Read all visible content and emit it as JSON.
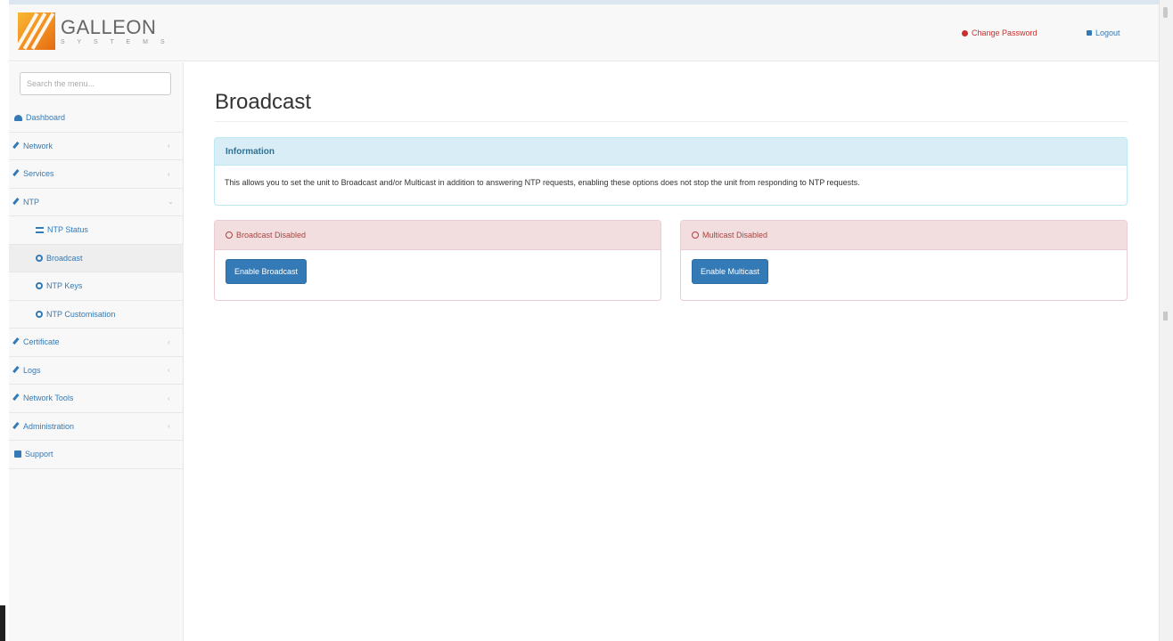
{
  "brand": {
    "name": "GALLEON",
    "subtitle": "S Y S T E M S"
  },
  "header": {
    "change_password": "Change Password",
    "logout": "Logout"
  },
  "sidebar": {
    "search_placeholder": "Search the menu...",
    "items": [
      {
        "label": "Dashboard",
        "icon": "dashboard-icon"
      },
      {
        "label": "Network",
        "icon": "wrench-icon",
        "expandable": true
      },
      {
        "label": "Services",
        "icon": "wrench-icon",
        "expandable": true
      },
      {
        "label": "NTP",
        "icon": "wrench-icon",
        "expandable": true,
        "expanded": true
      },
      {
        "label": "NTP Status",
        "icon": "list-icon",
        "sub": true
      },
      {
        "label": "Broadcast",
        "icon": "globe-icon",
        "sub": true,
        "active": true
      },
      {
        "label": "NTP Keys",
        "icon": "globe-icon",
        "sub": true
      },
      {
        "label": "NTP Customisation",
        "icon": "globe-icon",
        "sub": true
      },
      {
        "label": "Certificate",
        "icon": "wrench-icon",
        "expandable": true
      },
      {
        "label": "Logs",
        "icon": "wrench-icon",
        "expandable": true
      },
      {
        "label": "Network Tools",
        "icon": "wrench-icon",
        "expandable": true
      },
      {
        "label": "Administration",
        "icon": "wrench-icon",
        "expandable": true
      },
      {
        "label": "Support",
        "icon": "plus-square-icon"
      }
    ]
  },
  "page": {
    "title": "Broadcast"
  },
  "info_panel": {
    "heading": "Information",
    "body": "This allows you to set the unit to Broadcast and/or Multicast in addition to answering NTP requests, enabling these options does not stop the unit from responding to NTP requests."
  },
  "broadcast_panel": {
    "status": "Broadcast Disabled",
    "button": "Enable Broadcast"
  },
  "multicast_panel": {
    "status": "Multicast Disabled",
    "button": "Enable Multicast"
  },
  "colors": {
    "primary": "#337ab7",
    "danger": "#a94442",
    "info_bg": "#d9edf7",
    "danger_bg": "#f2dede"
  }
}
